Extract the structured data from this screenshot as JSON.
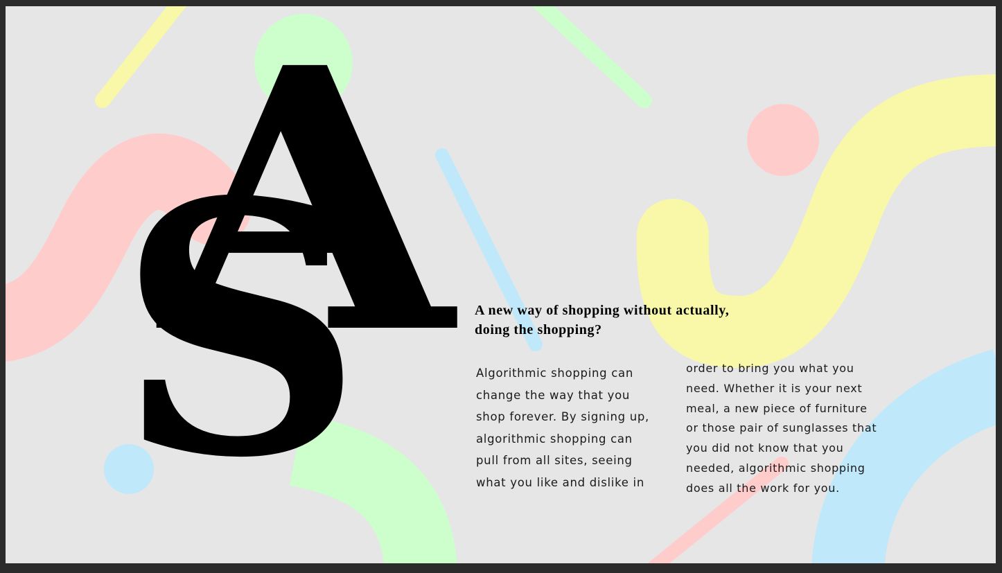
{
  "colors": {
    "background": "#e6e6e6",
    "frame": "#2b2b2b",
    "pink": "#ffcccc",
    "yellow": "#f8f8a8",
    "green": "#ccffcc",
    "blue": "#bfe9fa",
    "text": "#000000"
  },
  "monogram": {
    "letter_a": "A",
    "letter_s": "S"
  },
  "headline": {
    "line1": "A new way of shopping without actually,",
    "line2": "doing the shopping?"
  },
  "body": {
    "column1": [
      "Algorithmic shopping can",
      "change the way that you",
      "shop forever. By signing up,",
      "algorithmic shopping can",
      "pull from all sites, seeing",
      "what you like and dislike in"
    ],
    "column2": [
      "order to bring you what you",
      "need. Whether it is your next",
      "meal, a new piece of furniture",
      "or those pair of sunglasses that",
      "you did not know that you",
      "needed, algorithmic shopping",
      "does all the work for you."
    ]
  }
}
